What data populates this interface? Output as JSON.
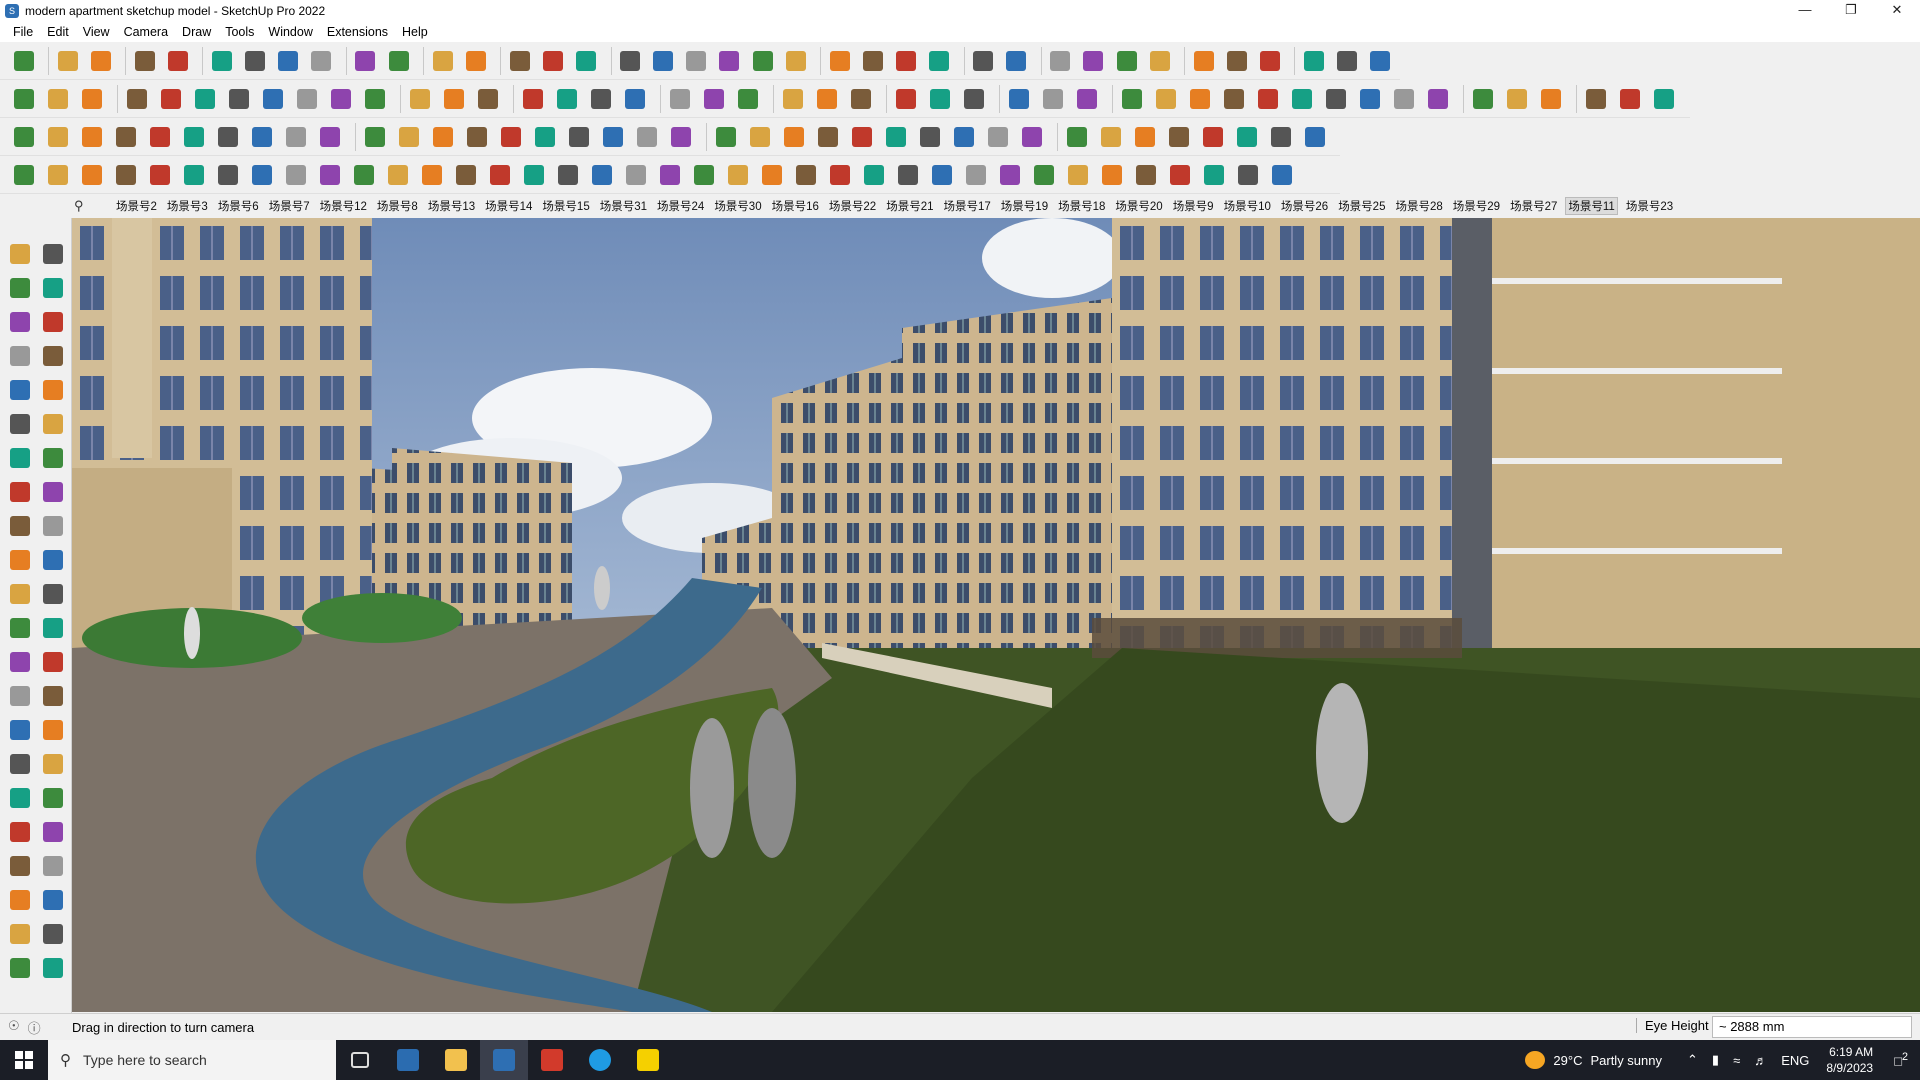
{
  "window": {
    "title": "modern apartment sketchup model - SketchUp Pro 2022",
    "app_icon": "sketchup-icon",
    "controls": {
      "minimize": "—",
      "maximize": "❐",
      "close": "✕"
    }
  },
  "menu": [
    "File",
    "Edit",
    "View",
    "Camera",
    "Draw",
    "Tools",
    "Window",
    "Extensions",
    "Help"
  ],
  "scenes": {
    "tabs": [
      "场景号2",
      "场景号3",
      "场景号6",
      "场景号7",
      "场景号12",
      "场景号8",
      "场景号13",
      "场景号14",
      "场景号15",
      "场景号31",
      "场景号24",
      "场景号30",
      "场景号16",
      "场景号22",
      "场景号21",
      "场景号17",
      "场景号19",
      "场景号18",
      "场景号20",
      "场景号9",
      "场景号10",
      "场景号26",
      "场景号25",
      "场景号28",
      "场景号29",
      "场景号27",
      "场景号11",
      "场景号23"
    ],
    "active": "场景号11"
  },
  "colors": {
    "sky": "#8fa7c9",
    "lawn": "#3f5424",
    "path": "#7c7268",
    "water": "#3d6a8c",
    "facade": "#cdb58e",
    "accent": "#2e6fb3"
  },
  "statusbar": {
    "hint": "Drag in direction to turn camera",
    "eye_height_label": "Eye Height",
    "eye_height_value": "~ 2888 mm"
  },
  "taskbar": {
    "search_placeholder": "Type here to search",
    "weather_temp": "29°C",
    "weather_text": "Partly sunny",
    "lang": "ENG",
    "time": "6:19 AM",
    "date": "8/9/2023",
    "notifications": "2"
  }
}
